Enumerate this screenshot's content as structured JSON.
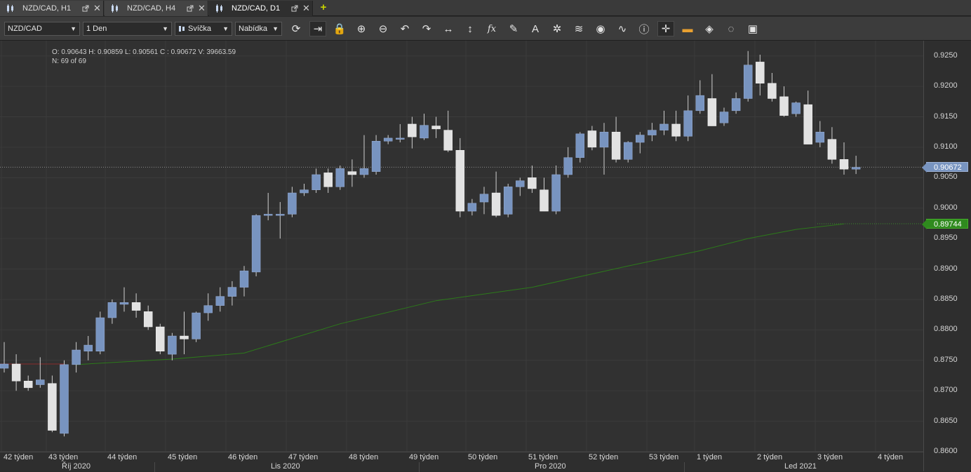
{
  "tabs": [
    {
      "label": "NZD/CAD, H1",
      "active": false
    },
    {
      "label": "NZD/CAD, H4",
      "active": false
    },
    {
      "label": "NZD/CAD, D1",
      "active": true
    }
  ],
  "toolbar": {
    "symbol": "NZD/CAD",
    "period": "1 Den",
    "chart_type": "Svíčka",
    "menu": "Nabídka",
    "tools": [
      "refresh-icon",
      "autoscroll-icon",
      "lock-icon",
      "zoom-in-icon",
      "zoom-out-icon",
      "undo-icon",
      "redo-icon",
      "horizontal-arrows-icon",
      "vertical-arrows-icon",
      "fx-icon",
      "pencil-icon",
      "text-icon",
      "spider-icon",
      "layers-icon",
      "eye-icon",
      "wave-icon",
      "info-icon",
      "crosshair-icon",
      "ruler-icon",
      "paint-bucket-icon",
      "circle-arrows-icon",
      "save-icon"
    ]
  },
  "info": {
    "ohlc": "O: 0.90643  H: 0.90859  L: 0.90561  C : 0.90672  V: 39663.59",
    "count": "N: 69 of 69"
  },
  "colors": {
    "bull": "#7894c0",
    "bear": "#e2e2e2",
    "wick": "#cfcfcf",
    "ma": "#2c7a1a",
    "grid": "#3b3b3b"
  },
  "chart_data": {
    "type": "candlestick",
    "ylim": [
      0.86,
      0.9275
    ],
    "yticks": [
      "0.9250",
      "0.9200",
      "0.9150",
      "0.9100",
      "0.9050",
      "0.9000",
      "0.8950",
      "0.8900",
      "0.8850",
      "0.8800",
      "0.8750",
      "0.8700",
      "0.8650",
      "0.8600"
    ],
    "x_week_labels": [
      "42 týden",
      "43 týden",
      "44 týden",
      "45 týden",
      "46 týden",
      "47 týden",
      "48 týden",
      "49 týden",
      "50 týden",
      "51 týden",
      "52 týden",
      "53 týden",
      "1 týden",
      "2 týden",
      "3 týden",
      "4 týden"
    ],
    "x_month_labels": [
      "Říj 2020",
      "Lis 2020",
      "Pro 2020",
      "Led 2021"
    ],
    "last_price": "0.90672",
    "ma_value": "0.89744",
    "candles": [
      [
        0.8737,
        0.878,
        0.873,
        0.8744
      ],
      [
        0.8744,
        0.876,
        0.87,
        0.8716
      ],
      [
        0.8716,
        0.8725,
        0.87,
        0.8705
      ],
      [
        0.871,
        0.8755,
        0.8705,
        0.8718
      ],
      [
        0.8712,
        0.8725,
        0.8632,
        0.8635
      ],
      [
        0.863,
        0.875,
        0.8625,
        0.8743
      ],
      [
        0.8743,
        0.878,
        0.873,
        0.8767
      ],
      [
        0.8765,
        0.879,
        0.875,
        0.8775
      ],
      [
        0.8765,
        0.883,
        0.876,
        0.882
      ],
      [
        0.882,
        0.885,
        0.881,
        0.8845
      ],
      [
        0.8842,
        0.887,
        0.883,
        0.8845
      ],
      [
        0.8845,
        0.886,
        0.882,
        0.8832
      ],
      [
        0.883,
        0.884,
        0.88,
        0.8805
      ],
      [
        0.8805,
        0.881,
        0.876,
        0.8765
      ],
      [
        0.876,
        0.8795,
        0.875,
        0.879
      ],
      [
        0.879,
        0.883,
        0.876,
        0.8785
      ],
      [
        0.8785,
        0.883,
        0.878,
        0.8828
      ],
      [
        0.8828,
        0.886,
        0.8815,
        0.884
      ],
      [
        0.884,
        0.887,
        0.883,
        0.8855
      ],
      [
        0.8855,
        0.888,
        0.884,
        0.887
      ],
      [
        0.887,
        0.8905,
        0.8855,
        0.8897
      ],
      [
        0.8895,
        0.899,
        0.8888,
        0.8988
      ],
      [
        0.8988,
        0.9025,
        0.898,
        0.899
      ],
      [
        0.8988,
        0.901,
        0.895,
        0.899
      ],
      [
        0.899,
        0.9035,
        0.8985,
        0.9025
      ],
      [
        0.9025,
        0.904,
        0.902,
        0.903
      ],
      [
        0.903,
        0.9065,
        0.9025,
        0.9055
      ],
      [
        0.9058,
        0.9065,
        0.9025,
        0.9035
      ],
      [
        0.9035,
        0.907,
        0.903,
        0.9065
      ],
      [
        0.906,
        0.908,
        0.9035,
        0.9055
      ],
      [
        0.9055,
        0.912,
        0.905,
        0.9065
      ],
      [
        0.906,
        0.912,
        0.9055,
        0.911
      ],
      [
        0.911,
        0.912,
        0.9105,
        0.9115
      ],
      [
        0.9113,
        0.9138,
        0.9108,
        0.9115
      ],
      [
        0.9138,
        0.915,
        0.9098,
        0.9117
      ],
      [
        0.9115,
        0.9155,
        0.9112,
        0.9136
      ],
      [
        0.9135,
        0.915,
        0.9115,
        0.913
      ],
      [
        0.9128,
        0.916,
        0.9092,
        0.9095
      ],
      [
        0.9095,
        0.9115,
        0.8985,
        0.8995
      ],
      [
        0.8995,
        0.9015,
        0.8988,
        0.9008
      ],
      [
        0.901,
        0.9035,
        0.899,
        0.9023
      ],
      [
        0.9025,
        0.906,
        0.8985,
        0.8988
      ],
      [
        0.899,
        0.904,
        0.8985,
        0.9035
      ],
      [
        0.9035,
        0.905,
        0.902,
        0.9045
      ],
      [
        0.905,
        0.907,
        0.9025,
        0.9032
      ],
      [
        0.903,
        0.905,
        0.8995,
        0.8995
      ],
      [
        0.8995,
        0.907,
        0.899,
        0.9055
      ],
      [
        0.9055,
        0.91,
        0.905,
        0.9083
      ],
      [
        0.9083,
        0.9125,
        0.9075,
        0.9122
      ],
      [
        0.9127,
        0.9135,
        0.9095,
        0.91
      ],
      [
        0.91,
        0.914,
        0.9055,
        0.9125
      ],
      [
        0.9125,
        0.915,
        0.9075,
        0.908
      ],
      [
        0.908,
        0.911,
        0.9075,
        0.9108
      ],
      [
        0.9108,
        0.9125,
        0.909,
        0.912
      ],
      [
        0.912,
        0.914,
        0.911,
        0.9128
      ],
      [
        0.9128,
        0.916,
        0.912,
        0.9138
      ],
      [
        0.9138,
        0.916,
        0.911,
        0.9118
      ],
      [
        0.9118,
        0.9185,
        0.911,
        0.916
      ],
      [
        0.916,
        0.921,
        0.9155,
        0.9185
      ],
      [
        0.918,
        0.922,
        0.9135,
        0.9135
      ],
      [
        0.914,
        0.9165,
        0.9135,
        0.9158
      ],
      [
        0.916,
        0.919,
        0.9155,
        0.918
      ],
      [
        0.918,
        0.9258,
        0.9175,
        0.9235
      ],
      [
        0.924,
        0.9252,
        0.9185,
        0.9205
      ],
      [
        0.9205,
        0.9222,
        0.9175,
        0.918
      ],
      [
        0.9183,
        0.92,
        0.915,
        0.9152
      ],
      [
        0.9155,
        0.9175,
        0.915,
        0.9173
      ],
      [
        0.917,
        0.9193,
        0.9105,
        0.9105
      ],
      [
        0.9108,
        0.9143,
        0.91,
        0.9125
      ],
      [
        0.9113,
        0.9133,
        0.9073,
        0.908
      ],
      [
        0.908,
        0.9108,
        0.9055,
        0.9064
      ],
      [
        0.9064,
        0.9086,
        0.9056,
        0.9067
      ]
    ],
    "ma": [
      [
        6,
        0.8743
      ],
      [
        14,
        0.8752
      ],
      [
        20,
        0.8762
      ],
      [
        28,
        0.881
      ],
      [
        36,
        0.8848
      ],
      [
        44,
        0.887
      ],
      [
        52,
        0.8905
      ],
      [
        58,
        0.893
      ],
      [
        62,
        0.895
      ],
      [
        66,
        0.8965
      ],
      [
        70,
        0.8974
      ]
    ]
  }
}
